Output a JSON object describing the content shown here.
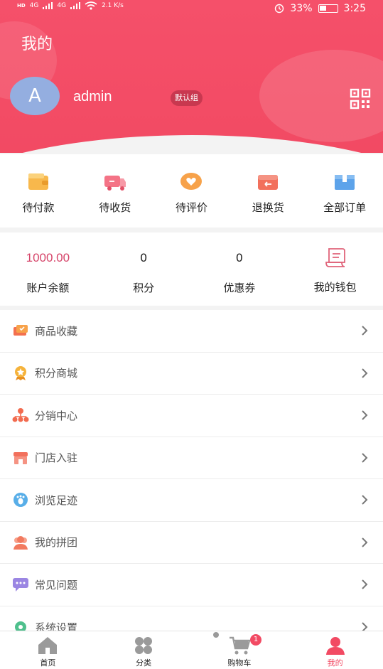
{
  "statusbar": {
    "network_left": "HD",
    "signal_1": "4G",
    "signal_2": "4G",
    "speed": "2.1 K/s",
    "battery": "33%",
    "time": "3:25"
  },
  "header": {
    "title": "我的",
    "avatar_letter": "A",
    "username": "admin",
    "group_badge": "默认组"
  },
  "orders": [
    {
      "label": "待付款",
      "icon": "wallet-icon"
    },
    {
      "label": "待收货",
      "icon": "truck-icon"
    },
    {
      "label": "待评价",
      "icon": "heart-comment-icon"
    },
    {
      "label": "退换货",
      "icon": "return-box-icon"
    },
    {
      "label": "全部订单",
      "icon": "box-icon"
    }
  ],
  "assets": {
    "balance": {
      "value": "1000.00",
      "label": "账户余额"
    },
    "points": {
      "value": "0",
      "label": "积分"
    },
    "coupons": {
      "value": "0",
      "label": "优惠券"
    },
    "wallet": {
      "label": "我的钱包",
      "icon": "receipt-icon"
    }
  },
  "menu": [
    {
      "label": "商品收藏",
      "icon": "collection-icon"
    },
    {
      "label": "积分商城",
      "icon": "medal-icon"
    },
    {
      "label": "分销中心",
      "icon": "hierarchy-icon"
    },
    {
      "label": "门店入驻",
      "icon": "store-icon"
    },
    {
      "label": "浏览足迹",
      "icon": "footprint-icon"
    },
    {
      "label": "我的拼团",
      "icon": "group-icon"
    },
    {
      "label": "常见问题",
      "icon": "chat-icon"
    },
    {
      "label": "系统设置",
      "icon": "settings-icon"
    }
  ],
  "tabbar": {
    "home": "首页",
    "category": "分类",
    "cart": "购物车",
    "cart_count": "1",
    "mine": "我的"
  },
  "colors": {
    "accent": "#f24a63",
    "balance": "#d6456a",
    "avatar": "#94aee0"
  }
}
